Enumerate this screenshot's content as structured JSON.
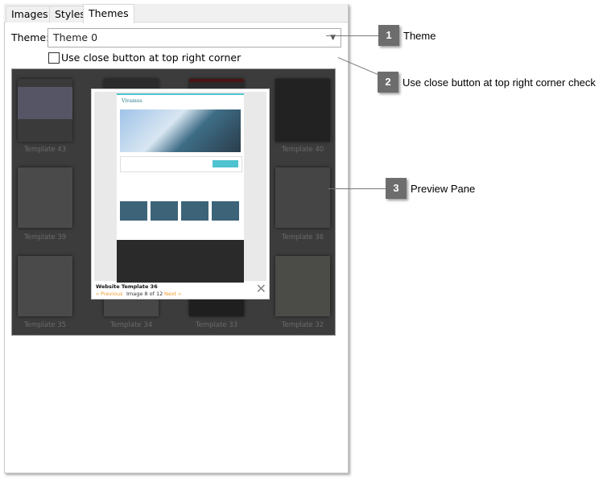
{
  "tabs": [
    {
      "label": "Images"
    },
    {
      "label": "Styles"
    },
    {
      "label": "Themes",
      "active": true
    }
  ],
  "theme": {
    "label": "Theme:",
    "value": "Theme 0"
  },
  "close_option": {
    "label": "Use close button at top right corner",
    "checked": false
  },
  "preview": {
    "thumbnails": [
      {
        "label": "Template 43"
      },
      {
        "label": "Template 40"
      },
      {
        "label": "Template 39"
      },
      {
        "label": "Template 36"
      },
      {
        "label": "Template 35"
      },
      {
        "label": "Template 34"
      },
      {
        "label": "Template 33"
      },
      {
        "label": "Template 32"
      }
    ],
    "popup": {
      "title": "Website Template 36",
      "previous": "« Previous",
      "counter": "Image 8 of 12",
      "next": "Next »",
      "site_name": "Vivamus"
    }
  },
  "callouts": [
    {
      "number": "1",
      "text": "Theme"
    },
    {
      "number": "2",
      "text": "Use close button at top right corner check"
    },
    {
      "number": "3",
      "text": "Preview Pane"
    }
  ],
  "colors": {
    "callout_bg": "#6d6d6d",
    "pane_bg": "#3c3c3c",
    "link": "#f39a2b",
    "accent": "#4fc3d0"
  }
}
